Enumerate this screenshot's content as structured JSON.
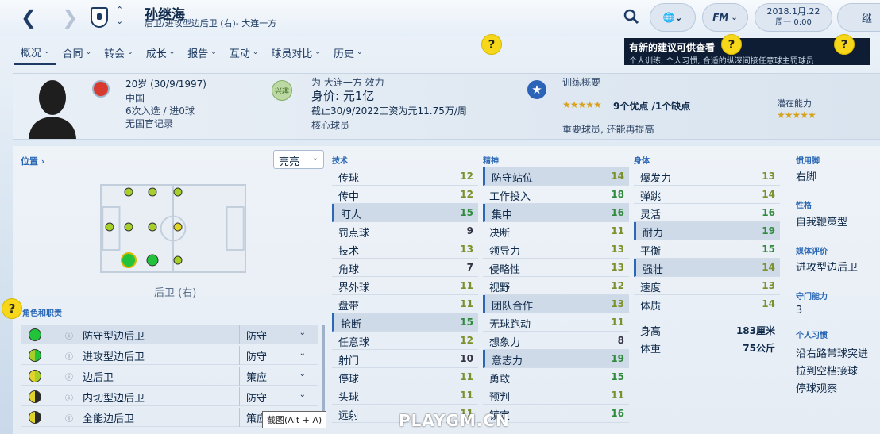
{
  "header": {
    "back_icon": "back-arrow-icon",
    "forward_icon": "forward-arrow-icon",
    "player_name": "孙继海",
    "player_subtitle": "后卫/进攻型边后卫 (右)- 大连一方",
    "date": "2018.1月.22",
    "time": "周一 0:00",
    "continue_label": "继",
    "fm_label": "FM"
  },
  "tabs": [
    {
      "label": "概况"
    },
    {
      "label": "合同"
    },
    {
      "label": "转会"
    },
    {
      "label": "成长"
    },
    {
      "label": "报告"
    },
    {
      "label": "互动"
    },
    {
      "label": "球员对比"
    },
    {
      "label": "历史"
    }
  ],
  "help_mark": "?",
  "notification": {
    "title": "有新的建议可供查看",
    "body": "个人训练, 个人习惯, 合适的纵深间接任意球主罚球员"
  },
  "info": {
    "age": "20岁 (30/9/1997)",
    "nation": "中国",
    "caps": "6次入选 / 进0球",
    "crime": "无国官记录",
    "club_line": "为 大连一方 效力",
    "value": "身价: 元1亿",
    "contract": "截止30/9/2022工资为元11.75万/周",
    "squad_status": "核心球员",
    "club_badge_text": "兴趣",
    "training_title": "训练概要",
    "training_summary": "9个优点 /1个缺点",
    "training_note": "重要球员, 还能再提高",
    "potential_title": "潜在能力",
    "current_stars": "★★★★★",
    "potential_stars": "★★★★★"
  },
  "position_panel": {
    "link": "位置 ›",
    "highlight": "亮亮",
    "position_label": "后卫 (右)",
    "roles_title": "角色和职责",
    "roles": [
      {
        "name": "防守型边后卫",
        "duty": "防守",
        "color": "#22c23a"
      },
      {
        "name": "进攻型边后卫",
        "duty": "防守",
        "color": "#a6cf2a"
      },
      {
        "name": "边后卫",
        "duty": "策应",
        "color": "#a6cf2a"
      },
      {
        "name": "内切型边后卫",
        "duty": "防守",
        "color": "#e0d42a"
      },
      {
        "name": "全能边后卫",
        "duty": "策应",
        "color": "#e0d42a"
      }
    ]
  },
  "attributes": {
    "technical_title": "技术",
    "technical": [
      {
        "name": "传球",
        "value": "12"
      },
      {
        "name": "传中",
        "value": "12"
      },
      {
        "name": "盯人",
        "value": "15"
      },
      {
        "name": "罚点球",
        "value": "9"
      },
      {
        "name": "技术",
        "value": "13"
      },
      {
        "name": "角球",
        "value": "7"
      },
      {
        "name": "界外球",
        "value": "11"
      },
      {
        "name": "盘带",
        "value": "11"
      },
      {
        "name": "抢断",
        "value": "15"
      },
      {
        "name": "任意球",
        "value": "12"
      },
      {
        "name": "射门",
        "value": "10"
      },
      {
        "name": "停球",
        "value": "11"
      },
      {
        "name": "头球",
        "value": "11"
      },
      {
        "name": "远射",
        "value": "11"
      }
    ],
    "mental_title": "精神",
    "mental": [
      {
        "name": "防守站位",
        "value": "14"
      },
      {
        "name": "工作投入",
        "value": "18"
      },
      {
        "name": "集中",
        "value": "16"
      },
      {
        "name": "决断",
        "value": "11"
      },
      {
        "name": "领导力",
        "value": "13"
      },
      {
        "name": "侵略性",
        "value": "13"
      },
      {
        "name": "视野",
        "value": "12"
      },
      {
        "name": "团队合作",
        "value": "13"
      },
      {
        "name": "无球跑动",
        "value": "11"
      },
      {
        "name": "想象力",
        "value": "8"
      },
      {
        "name": "意志力",
        "value": "19"
      },
      {
        "name": "勇敢",
        "value": "15"
      },
      {
        "name": "预判",
        "value": "11"
      },
      {
        "name": "镇定",
        "value": "16"
      }
    ],
    "physical_title": "身体",
    "physical": [
      {
        "name": "爆发力",
        "value": "13"
      },
      {
        "name": "弹跳",
        "value": "14"
      },
      {
        "name": "灵活",
        "value": "16"
      },
      {
        "name": "耐力",
        "value": "19"
      },
      {
        "name": "平衡",
        "value": "15"
      },
      {
        "name": "强壮",
        "value": "14"
      },
      {
        "name": "速度",
        "value": "13"
      },
      {
        "name": "体质",
        "value": "14"
      }
    ],
    "height_label": "身高",
    "height": "183厘米",
    "weight_label": "体重",
    "weight": "75公斤"
  },
  "side": {
    "foot_title": "惯用脚",
    "foot": "右脚",
    "personality_title": "性格",
    "personality": "自我鞭策型",
    "media_title": "媒体评价",
    "media": "进攻型边后卫",
    "gk_title": "守门能力",
    "gk": "3",
    "habits_title": "个人习惯",
    "habits": [
      "沿右路带球突进",
      "拉到空档接球",
      "停球观察"
    ]
  },
  "tooltip": "截图(Alt + A)",
  "watermark": "PLAYGM.CN"
}
